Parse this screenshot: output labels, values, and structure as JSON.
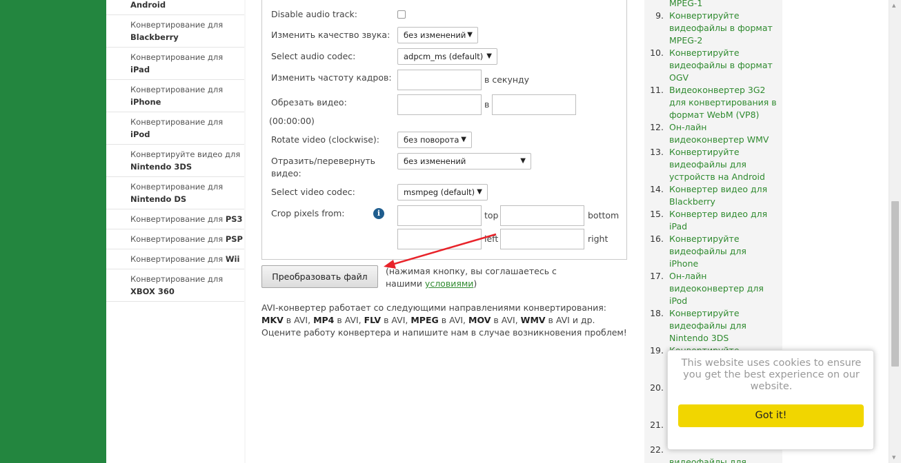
{
  "left_nav": [
    {
      "plain": "",
      "bold": "Android"
    },
    {
      "plain": "Конвертирование для ",
      "bold": "Blackberry"
    },
    {
      "plain": "Конвертирование для ",
      "bold": "iPad"
    },
    {
      "plain": "Конвертирование для ",
      "bold": "iPhone"
    },
    {
      "plain": "Конвертирование для ",
      "bold": "iPod"
    },
    {
      "plain": "Конвертируйте видео для ",
      "bold": "Nintendo 3DS"
    },
    {
      "plain": "Конвертирование для ",
      "bold": "Nintendo DS"
    },
    {
      "plain": "Конвертирование для ",
      "bold": "PS3"
    },
    {
      "plain": "Конвертирование для ",
      "bold": "PSP"
    },
    {
      "plain": "Конвертирование для ",
      "bold": "Wii"
    },
    {
      "plain": "Конвертирование для ",
      "bold": "XBOX 360"
    }
  ],
  "form": {
    "disable_audio_label": "Disable audio track:",
    "audio_quality_label": "Изменить качество звука:",
    "audio_quality_value": "без изменений",
    "audio_codec_label": "Select audio codec:",
    "audio_codec_value": "adpcm_ms (default)",
    "framerate_label": "Изменить частоту кадров:",
    "framerate_unit": "в секунду",
    "cut_label": "Обрезать видео:",
    "cut_sep": "в",
    "cut_hint": "(00:00:00)",
    "rotate_label": "Rotate video (clockwise):",
    "rotate_value": "без поворота",
    "flip_label_1": "Отразить/перевернуть",
    "flip_label_2": "видео:",
    "flip_value": "без изменений",
    "video_codec_label": "Select video codec:",
    "video_codec_value": "msmpeg (default)",
    "crop_label": "Crop pixels from:",
    "crop_top": "top",
    "crop_bottom": "bottom",
    "crop_left": "left",
    "crop_right": "right"
  },
  "convert_button": "Преобразовать файл",
  "agree_text": "(нажимая кнопку, вы соглашаетесь с нашими ",
  "agree_link": "условиями",
  "agree_end": ")",
  "about": {
    "p1": "AVI-конвертер работает со следующими направлениями конвертирования: ",
    "b1": "MKV",
    "p2": " в AVI, ",
    "b2": "MP4",
    "p3": " в AVI, ",
    "b3": "FLV",
    "p4": " в AVI, ",
    "b4": "MPEG",
    "p5": " в AVI, ",
    "b5": "MOV",
    "p6": " в AVI, ",
    "b6": "WMV",
    "p7": " в AVI и др. Оцените работу конвертера и напишите нам в случае возникновения проблем!"
  },
  "right_list": [
    {
      "num": "",
      "text": "MPEG-1"
    },
    {
      "num": "9.",
      "text": "Конвертируйте видеофайлы в формат MPEG-2"
    },
    {
      "num": "10.",
      "text": "Конвертируйте видеофайлы в формат OGV"
    },
    {
      "num": "11.",
      "text": "Видеоконвертер 3G2 для конвертирования в формат WebM (VP8)"
    },
    {
      "num": "12.",
      "text": "Он-лайн видеоконвертер WMV"
    },
    {
      "num": "13.",
      "text": "Конвертируйте видеофайлы для устройств на Android"
    },
    {
      "num": "14.",
      "text": "Конвертер видео для Blackberry"
    },
    {
      "num": "15.",
      "text": "Конвертер видео для iPad"
    },
    {
      "num": "16.",
      "text": "Конвертируйте видеофайлы для iPhone"
    },
    {
      "num": "17.",
      "text": "Он-лайн видеоконвертер для iPod"
    },
    {
      "num": "18.",
      "text": "Конвертируйте видеофайлы для Nintendo 3DS"
    },
    {
      "num": "19.",
      "text": "Конвертируйте"
    },
    {
      "num": "",
      "text": ""
    },
    {
      "num": "",
      "text": ""
    },
    {
      "num": "20.",
      "text": ""
    },
    {
      "num": "",
      "text": ""
    },
    {
      "num": "",
      "text": ""
    },
    {
      "num": "21.",
      "text": ""
    },
    {
      "num": "",
      "text": ""
    },
    {
      "num": "22.",
      "text": ""
    },
    {
      "num": "",
      "text": "видеофайлы для"
    }
  ],
  "cookie": {
    "message": "This website uses cookies to ensure you get the best experience on our website.",
    "button": "Got it!"
  },
  "colors": {
    "brand_green": "#23863f",
    "link_green": "#2f8a2f",
    "cookie_button": "#f1d600",
    "arrow_red": "#e8232a"
  }
}
